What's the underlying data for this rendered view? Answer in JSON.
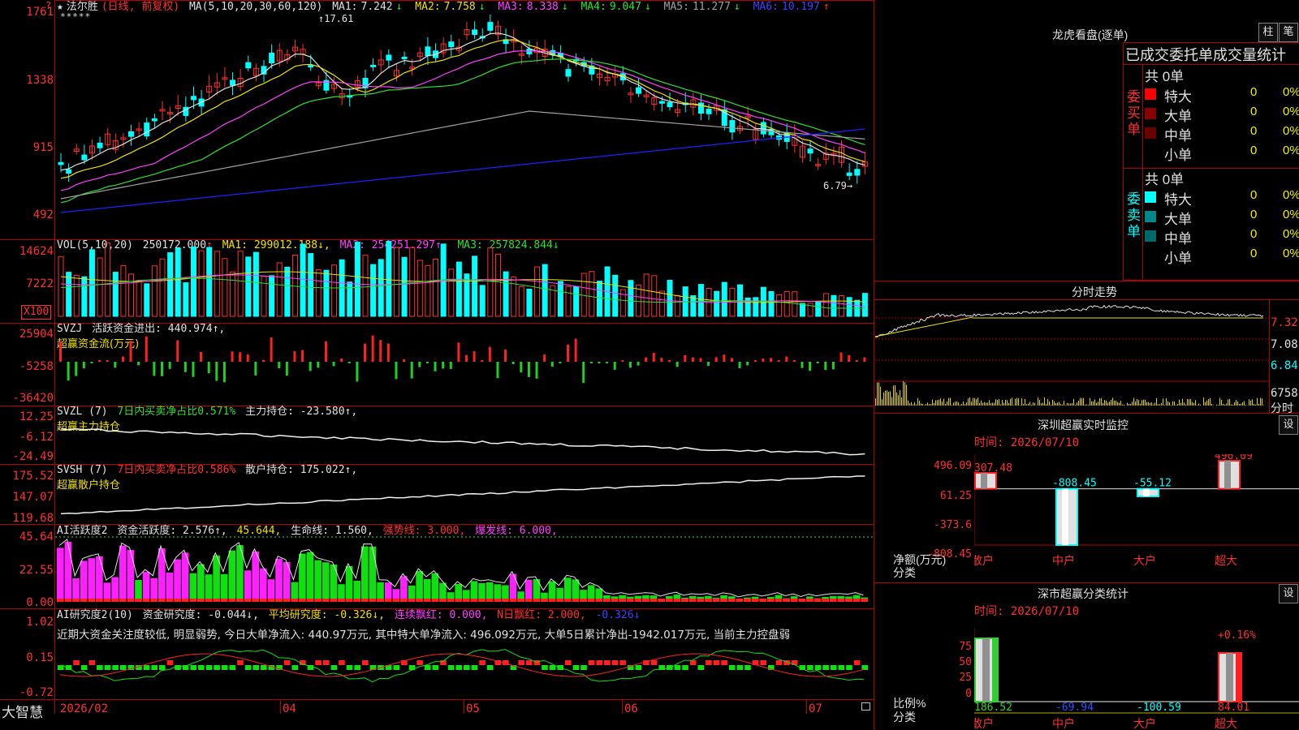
{
  "main_chart": {
    "star": "★",
    "name": "法尔胜",
    "mode": "(日线, 前复权)",
    "ma_label": "MA(5,10,20,30,60,120)",
    "ma": [
      {
        "name": "MA1:",
        "value": "7.242",
        "arrow": "↓"
      },
      {
        "name": "MA2:",
        "value": "7.758",
        "arrow": "↓"
      },
      {
        "name": "MA3:",
        "value": "8.338",
        "arrow": "↓"
      },
      {
        "name": "MA4:",
        "value": "9.047",
        "arrow": "↓"
      },
      {
        "name": "MA5:",
        "value": "11.277",
        "arrow": "↓"
      },
      {
        "name": "MA6:",
        "value": "10.197",
        "arrow": "↑"
      }
    ],
    "y_labels": [
      "1761",
      "1338",
      "915",
      "492"
    ],
    "high_mark": "17.61",
    "low_mark": "6.79",
    "top_marker": "?",
    "stars": "*****",
    "colors": {
      "up": "#ff3030",
      "down": "#00ffff",
      "ma1": "#e0e0e0",
      "ma2": "#f0e000",
      "ma3": "#ff40ff",
      "ma4": "#30e030",
      "ma5": "#a0a0a0",
      "ma6": "#2020ff"
    }
  },
  "volume": {
    "label": "VOL(5,10,20)",
    "value": "250172.000",
    "arrow": "↑",
    "ma1": "MA1: 299012.188↓,",
    "ma2": "MA2: 254251.297↑,",
    "ma3": "MA3: 257824.844↓",
    "y_labels": [
      "14624",
      "7222"
    ],
    "unit": "X100"
  },
  "svzj": {
    "label": "SVZJ",
    "text": "活跃资金进出: 440.974↑,",
    "subtitle": "超赢资金流(万元)",
    "y_labels": [
      "25904",
      "-5258",
      "-36420"
    ]
  },
  "svzl": {
    "label": "SVZL (7)",
    "text1": "7日内买卖净占比0.571%",
    "text2": "主力持仓: -23.580↑,",
    "subtitle": "超赢主力持仓",
    "y_labels": [
      "12.25",
      "-6.12",
      "-24.49"
    ]
  },
  "svsh": {
    "label": "SVSH (7)",
    "text1": "7日内买卖净占比0.586%",
    "text2": "散户持仓: 175.022↑,",
    "subtitle": "超赢散户持仓",
    "y_labels": [
      "175.52",
      "147.07",
      "119.68"
    ]
  },
  "huoyue": {
    "label": "AI活跃度2",
    "text1": "资金活跃度: 2.576↑,",
    "text2": "45.644,",
    "text3": "生命线: 1.560,",
    "text4": "强势线: 3.000,",
    "text5": "爆发线: 6.000,",
    "y_labels": [
      "45.64",
      "22.55",
      "0.00"
    ]
  },
  "yanjiu": {
    "label": "AI研究度2(10)",
    "text1": "资金研究度: -0.044↓,",
    "text2": "平均研究度: -0.326↓,",
    "text3": "连续飘红: 0.000,",
    "text4": "N日飘红: 2.000,",
    "text5": "-0.326↓",
    "comment": "近期大资金关注度较低, 明显弱势, 今日大单净流入: 440.97万元, 其中特大单净流入: 496.092万元, 大单5日累计净出-1942.017万元, 当前主力控盘弱",
    "y_labels": [
      "1.02",
      "0.15",
      "-0.72"
    ]
  },
  "bottom_bar": {
    "logo": "大智慧",
    "dates": [
      "2026/02",
      "04",
      "05",
      "06",
      "07"
    ]
  },
  "longhu": {
    "title": "龙虎看盘(逐单)",
    "btn1": "柱",
    "btn2": "笔",
    "table_title": "已成交委托单成交量统计",
    "buy_total": "共 0单",
    "sell_total": "共 0单",
    "buy_label": "委买单",
    "sell_label": "委卖单",
    "buy_rows": [
      {
        "label": "特大",
        "v1": "0",
        "v2": "0%",
        "color": "#ff0000"
      },
      {
        "label": "大单",
        "v1": "0",
        "v2": "0%",
        "color": "#8a0000"
      },
      {
        "label": "中单",
        "v1": "0",
        "v2": "0%",
        "color": "#6a0000"
      },
      {
        "label": "小单",
        "v1": "0",
        "v2": "0%",
        "color": "#000000"
      }
    ],
    "sell_rows": [
      {
        "label": "特大",
        "v1": "0",
        "v2": "0%",
        "color": "#00ffff"
      },
      {
        "label": "大单",
        "v1": "0",
        "v2": "0%",
        "color": "#008888"
      },
      {
        "label": "中单",
        "v1": "0",
        "v2": "0%",
        "color": "#006a6a"
      },
      {
        "label": "小单",
        "v1": "0",
        "v2": "0%",
        "color": "#000000"
      }
    ]
  },
  "fenshi": {
    "title": "分时走势",
    "y_labels": [
      "7.32",
      "7.08",
      "6.84"
    ],
    "vol_label": "6758",
    "vol_unit": "分时"
  },
  "sz_monitor": {
    "title": "深圳超赢实时监控",
    "set": "设",
    "time": "时间: 2026/07/10",
    "y_labels": [
      "496.09",
      "61.25",
      "-373.6",
      "-808.45"
    ],
    "y_unit1": "净额(万元)",
    "y_unit2": "分类",
    "bars": [
      {
        "cat": "散户",
        "value": 307.48,
        "label": "307.48"
      },
      {
        "cat": "中户",
        "value": -808.45,
        "label": "-808.45"
      },
      {
        "cat": "大户",
        "value": -55.12,
        "label": "-55.12"
      },
      {
        "cat": "超大",
        "value": 496.09,
        "label": "496.09"
      }
    ]
  },
  "sz_classify": {
    "title": "深市超赢分类统计",
    "set": "设",
    "time": "时间: 2026/07/10",
    "y_labels": [
      "75",
      "50",
      "25",
      "0"
    ],
    "y_unit1": "比例%",
    "y_unit2": "分类",
    "top_label": "+0.16%",
    "bars": [
      {
        "cat": "散户",
        "label": "186.52"
      },
      {
        "cat": "中户",
        "label": "-69.94"
      },
      {
        "cat": "大户",
        "label": "-100.59"
      },
      {
        "cat": "超大",
        "label": "84.01"
      }
    ]
  }
}
